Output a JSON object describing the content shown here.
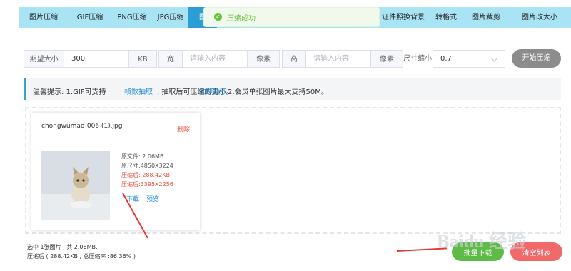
{
  "tabs": [
    {
      "label": "图片压缩"
    },
    {
      "label": "GIF压缩"
    },
    {
      "label": "PNG压缩"
    },
    {
      "label": "JPG压缩"
    },
    {
      "label": "图"
    },
    {
      "label": "证件照换背景"
    },
    {
      "label": "转格式"
    },
    {
      "label": "图片裁剪"
    },
    {
      "label": "图片改大小"
    }
  ],
  "toast": {
    "text": "压缩成功",
    "color": "#67c23a"
  },
  "form": {
    "size_label": "期望大小",
    "size_value": "300",
    "size_unit": "KB",
    "width_label": "宽",
    "width_placeholder": "请输入内容",
    "width_unit": "像素",
    "height_label": "高",
    "height_placeholder": "请输入内容",
    "height_unit": "像素",
    "scale_label": "尺寸缩小",
    "scale_value": "0.7",
    "start_button": "开始压缩"
  },
  "tip": {
    "prefix": "温馨提示: 1.GIF可支持",
    "link1": "帧数抽取",
    "middle": ", 抽取后可压缩的更小。",
    "link2": "立即抽取",
    "suffix": "2.会员单张图片最大支持50M。"
  },
  "file": {
    "name": "chongwumao-006 (1).jpg",
    "delete": "删除",
    "orig_size": "原文件: 2.06MB",
    "orig_dim": "原尺寸:4850X3224",
    "comp_size": "压缩后: 288.42KB",
    "comp_dim": "压缩后:3395X2256",
    "download": "下载",
    "preview": "预览"
  },
  "summary": {
    "line1": "选中 1张图片 , 共 2.06MB.",
    "line2": "压缩后 ( 288.42KB , 总压缩率 :86.36% )"
  },
  "actions": {
    "green_label": "批量下载",
    "red_label": "清空列表"
  },
  "watermark": "Baidu 经验",
  "colors": {
    "tab_bar": "#a9e4f5",
    "tab_active": "#2a9fd6",
    "accent_blue": "#2a8fd6",
    "delete_red": "#e74c3c",
    "green": "#5dbb46",
    "red": "#f06a6a"
  }
}
